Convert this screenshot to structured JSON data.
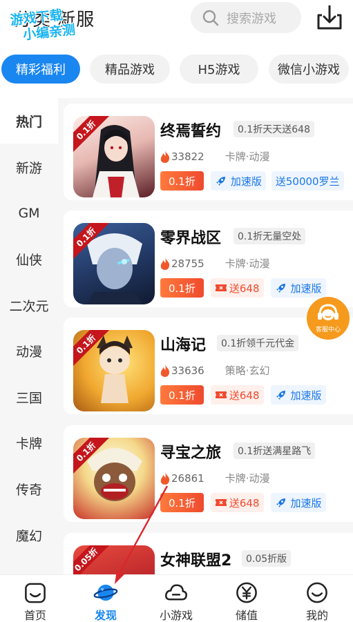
{
  "header": {
    "title": "分类·新服",
    "watermark_line1": "游戏下载",
    "watermark_line2": "小编亲测",
    "search_placeholder": "搜索游戏",
    "search_icon": "search-icon",
    "download_icon": "download-icon"
  },
  "tabs": [
    {
      "label": "精彩福利",
      "active": true
    },
    {
      "label": "精品游戏",
      "active": false
    },
    {
      "label": "H5游戏",
      "active": false
    },
    {
      "label": "微信小游戏",
      "active": false
    }
  ],
  "categories": [
    {
      "label": "热门",
      "active": true
    },
    {
      "label": "新游"
    },
    {
      "label": "GM"
    },
    {
      "label": "仙侠"
    },
    {
      "label": "二次元"
    },
    {
      "label": "动漫"
    },
    {
      "label": "三国"
    },
    {
      "label": "卡牌"
    },
    {
      "label": "传奇"
    },
    {
      "label": "魔幻"
    }
  ],
  "games": [
    {
      "name": "终焉誓约",
      "tag": "0.1折天天送648",
      "hot": "33822",
      "genre": "卡牌·动漫",
      "discount": "0.1折",
      "ribbon": "0.1折",
      "badge2": "加速版",
      "badge3": "送50000罗兰",
      "color": "#e8d5d0"
    },
    {
      "name": "零界战区",
      "tag": "0.1折无量空处",
      "hot": "28755",
      "genre": "卡牌·动漫",
      "discount": "0.1折",
      "ribbon": "0.1折",
      "badge2": "送648",
      "badge3": "加速版",
      "color": "#2a3f6a"
    },
    {
      "name": "山海记",
      "tag": "0.1折领千元代金",
      "hot": "33636",
      "genre": "策略·玄幻",
      "discount": "0.1折",
      "ribbon": "0.1折",
      "badge2": "送648",
      "badge3": "加速版",
      "color": "#f2b43a"
    },
    {
      "name": "寻宝之旅",
      "tag": "0.1折送满星路飞",
      "hot": "26861",
      "genre": "卡牌·动漫",
      "discount": "0.1折",
      "ribbon": "0.1折",
      "badge2": "送648",
      "badge3": "加速版",
      "color": "#f4e6b8"
    },
    {
      "name": "女神联盟2",
      "tag": "0.05折版",
      "ribbon": "0.05折",
      "color": "#b8242a"
    }
  ],
  "service": {
    "label": "客服中心",
    "icon": "headset-icon"
  },
  "nav": [
    {
      "label": "首页",
      "icon": "home-icon"
    },
    {
      "label": "发现",
      "icon": "planet-icon",
      "active": true
    },
    {
      "label": "小游戏",
      "icon": "cloud-icon"
    },
    {
      "label": "储值",
      "icon": "yuan-icon"
    },
    {
      "label": "我的",
      "icon": "smile-icon"
    }
  ],
  "colors": {
    "accent": "#1a86f0",
    "discount": "#ee4a2e",
    "service": "#f59a1c"
  }
}
